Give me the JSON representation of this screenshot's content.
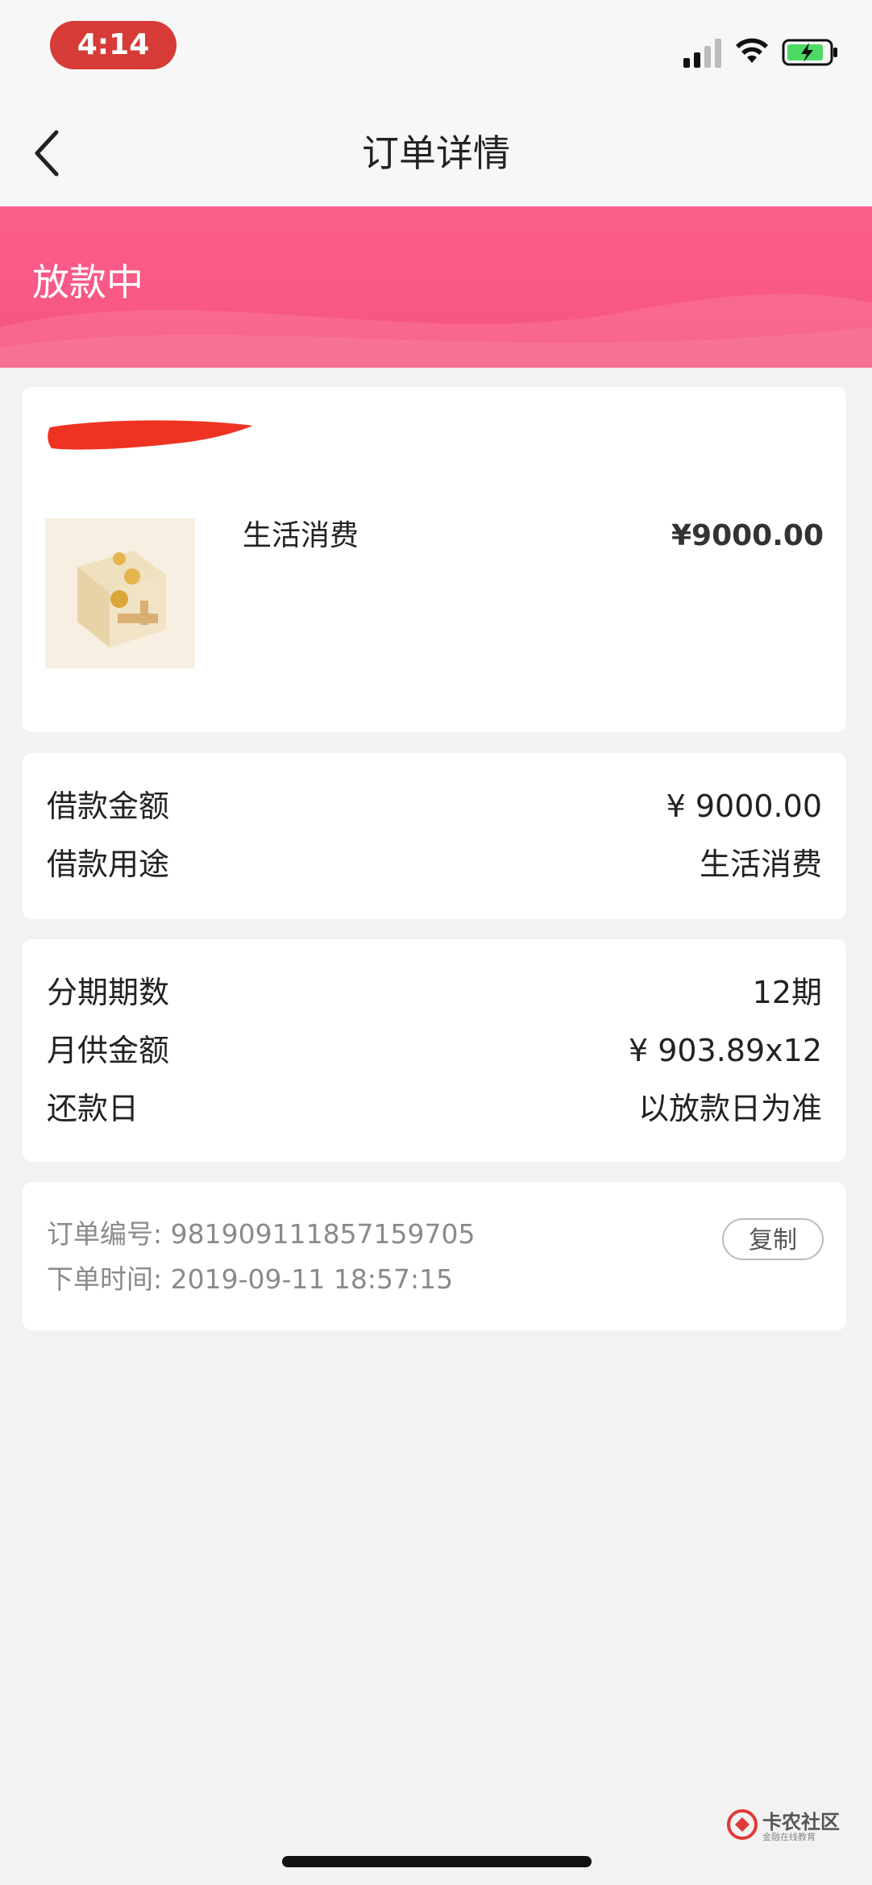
{
  "status_bar": {
    "time": "4:14",
    "icons": [
      "signal-icon",
      "wifi-icon",
      "battery-charging-icon"
    ],
    "time_pill_color": "#d63b37"
  },
  "nav": {
    "back_icon": "chevron-left-icon",
    "title": "订单详情"
  },
  "banner": {
    "status_text": "放款中",
    "color": "#f7578a"
  },
  "product_card": {
    "name": "生活消费",
    "price": "¥9000.00",
    "thumbnail_icon": "coin-box-icon"
  },
  "loan_card": {
    "rows": [
      {
        "label": "借款金额",
        "value": "¥ 9000.00"
      },
      {
        "label": "借款用途",
        "value": "生活消费"
      }
    ]
  },
  "installment_card": {
    "rows": [
      {
        "label": "分期期数",
        "value": "12期"
      },
      {
        "label": "月供金额",
        "value": "¥ 903.89x12"
      },
      {
        "label": "还款日",
        "value": "以放款日为准"
      }
    ]
  },
  "order_info": {
    "order_no": "订单编号: 981909111857159705",
    "order_time": "下单时间: 2019-09-11 18:57:15",
    "copy_label": "复制"
  },
  "watermark": {
    "name": "卡农社区",
    "sub": "金融在线教育"
  }
}
